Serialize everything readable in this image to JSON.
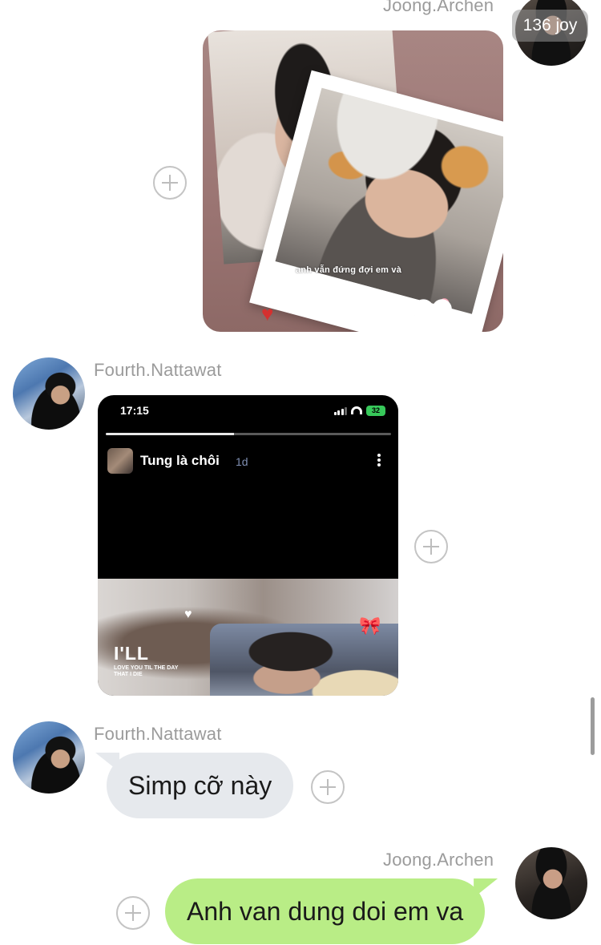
{
  "overlay": {
    "counter_label": "136 joy"
  },
  "messages": [
    {
      "sender": "Joong.Archen",
      "type": "image",
      "image_caption": "anh vẫn đứng đợi em và"
    },
    {
      "sender": "Fourth.Nattawat",
      "type": "image",
      "story": {
        "time": "17:15",
        "battery": "32",
        "account": "Tung là chôi",
        "age": "1d",
        "progress": 0.45,
        "media_title": "I'LL",
        "media_subtitle": "LOVE YOU TIL THE DAY THAT I DIE"
      }
    },
    {
      "sender": "Fourth.Nattawat",
      "type": "text",
      "text": "Simp cỡ này"
    },
    {
      "sender": "Joong.Archen",
      "type": "text",
      "text": "Anh van dung doi em va"
    }
  ],
  "colors": {
    "outgoing_bubble": "#b9ed86",
    "incoming_bubble": "#e6e9ed",
    "sender_name": "#9b9b9b",
    "battery": "#37c85a"
  },
  "icons": [
    "plus-icon",
    "heart-icon",
    "bow-icon",
    "more-icon",
    "signal-icon",
    "wifi-icon",
    "battery-icon"
  ]
}
